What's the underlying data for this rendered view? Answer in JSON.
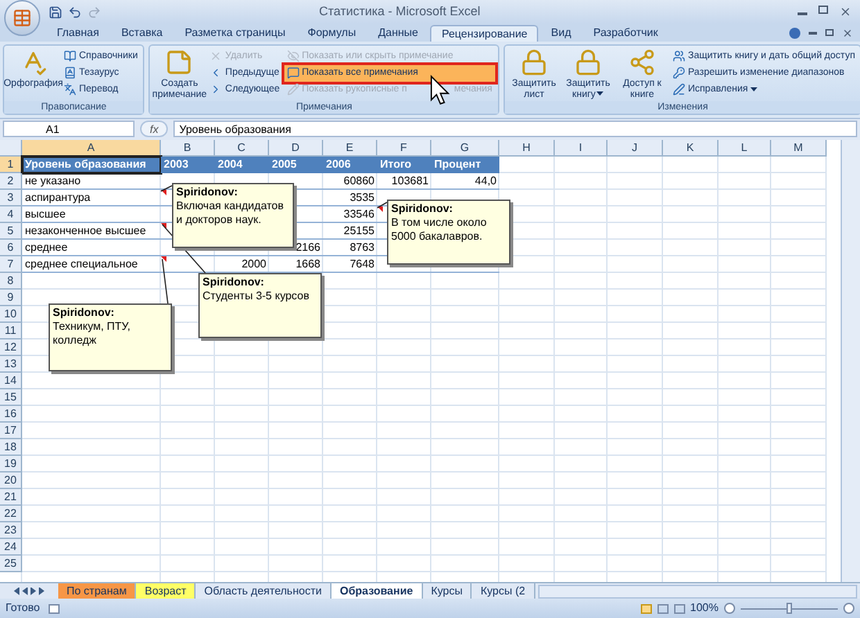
{
  "window": {
    "title": "Статистика - Microsoft Excel"
  },
  "ribbon_tabs": [
    {
      "label": "Главная",
      "selected": false
    },
    {
      "label": "Вставка",
      "selected": false
    },
    {
      "label": "Разметка страницы",
      "selected": false
    },
    {
      "label": "Формулы",
      "selected": false
    },
    {
      "label": "Данные",
      "selected": false
    },
    {
      "label": "Рецензирование",
      "selected": true
    },
    {
      "label": "Вид",
      "selected": false
    },
    {
      "label": "Разработчик",
      "selected": false
    }
  ],
  "ribbon_groups": [
    {
      "title": "Правописание",
      "items": [
        {
          "label": "Орфография",
          "kind": "large",
          "disabled": false
        },
        {
          "label": "Справочники",
          "kind": "small",
          "disabled": false
        },
        {
          "label": "Тезаурус",
          "kind": "small",
          "disabled": false
        },
        {
          "label": "Перевод",
          "kind": "small",
          "disabled": false
        }
      ]
    },
    {
      "title": "Примечания",
      "items": [
        {
          "label": "Создать примечание",
          "kind": "large",
          "disabled": false
        },
        {
          "label": "Удалить",
          "kind": "small",
          "disabled": true
        },
        {
          "label": "Предыдуще",
          "kind": "small",
          "disabled": false
        },
        {
          "label": "Следующее",
          "kind": "small",
          "disabled": false
        },
        {
          "label": "Показать или скрыть примечание",
          "kind": "small",
          "disabled": true
        },
        {
          "label": "Показать все примечания",
          "kind": "small",
          "disabled": false,
          "highlighted": true
        },
        {
          "label": "Показать рукописные п",
          "label_tail": "мечания",
          "kind": "small",
          "disabled": true
        }
      ]
    },
    {
      "title": "Изменения",
      "items": [
        {
          "label": "Защитить лист",
          "kind": "large",
          "disabled": false
        },
        {
          "label": "Защитить книгу",
          "kind": "large",
          "disabled": false,
          "dropdown": true
        },
        {
          "label": "Доступ к книге",
          "kind": "large",
          "disabled": false
        },
        {
          "label": "Защитить книгу и дать общий доступ",
          "kind": "small",
          "disabled": false
        },
        {
          "label": "Разрешить изменение диапазонов",
          "kind": "small",
          "disabled": false
        },
        {
          "label": "Исправления",
          "kind": "small",
          "disabled": false,
          "dropdown": true
        }
      ]
    }
  ],
  "name_box": "A1",
  "formula_label": "fx",
  "formula": "Уровень образования",
  "columns": [
    {
      "label": "A",
      "selected": true
    },
    {
      "label": "B",
      "selected": false
    },
    {
      "label": "C",
      "selected": false
    },
    {
      "label": "D",
      "selected": false
    },
    {
      "label": "E",
      "selected": false
    },
    {
      "label": "F",
      "selected": false
    },
    {
      "label": "G",
      "selected": false
    },
    {
      "label": "H",
      "selected": false
    },
    {
      "label": "I",
      "selected": false
    },
    {
      "label": "J",
      "selected": false
    },
    {
      "label": "K",
      "selected": false
    },
    {
      "label": "L",
      "selected": false
    },
    {
      "label": "M",
      "selected": false
    }
  ],
  "rows": [
    {
      "number": "1",
      "selected": true,
      "kind": "header",
      "cells": {
        "A": "Уровень образования",
        "B": "2003",
        "C": "2004",
        "D": "2005",
        "E": "2006",
        "F": "Итого",
        "G": "Процент"
      }
    },
    {
      "number": "2",
      "selected": false,
      "kind": "data",
      "cells": {
        "A": "не указано",
        "E": "60860",
        "F": "103681",
        "G": "44,0"
      }
    },
    {
      "number": "3",
      "selected": false,
      "kind": "data",
      "cells": {
        "A": "аспирантура",
        "E": "3535"
      }
    },
    {
      "number": "4",
      "selected": false,
      "kind": "data",
      "cells": {
        "A": "высшее",
        "E": "33546"
      }
    },
    {
      "number": "5",
      "selected": false,
      "kind": "data",
      "cells": {
        "A": "незаконченное высшее",
        "E": "25155"
      }
    },
    {
      "number": "6",
      "selected": false,
      "kind": "data",
      "cells": {
        "A": "среднее",
        "D": "2166",
        "E": "8763"
      }
    },
    {
      "number": "7",
      "selected": false,
      "kind": "data",
      "cells": {
        "A": "среднее специальное",
        "C": "2000",
        "D": "1668",
        "E": "7648"
      }
    },
    {
      "number": "8",
      "selected": false,
      "kind": "blank"
    },
    {
      "number": "9",
      "selected": false,
      "kind": "blank"
    },
    {
      "number": "10",
      "selected": false,
      "kind": "blank"
    },
    {
      "number": "11",
      "selected": false,
      "kind": "blank"
    },
    {
      "number": "12",
      "selected": false,
      "kind": "blank"
    },
    {
      "number": "13",
      "selected": false,
      "kind": "blank"
    },
    {
      "number": "14",
      "selected": false,
      "kind": "blank"
    },
    {
      "number": "15",
      "selected": false,
      "kind": "blank"
    },
    {
      "number": "16",
      "selected": false,
      "kind": "blank"
    },
    {
      "number": "17",
      "selected": false,
      "kind": "blank"
    },
    {
      "number": "18",
      "selected": false,
      "kind": "blank"
    },
    {
      "number": "19",
      "selected": false,
      "kind": "blank"
    },
    {
      "number": "20",
      "selected": false,
      "kind": "blank"
    },
    {
      "number": "21",
      "selected": false,
      "kind": "blank"
    },
    {
      "number": "22",
      "selected": false,
      "kind": "blank"
    },
    {
      "number": "23",
      "selected": false,
      "kind": "blank"
    },
    {
      "number": "24",
      "selected": false,
      "kind": "blank"
    },
    {
      "number": "25",
      "selected": false,
      "kind": "blank"
    }
  ],
  "comments": [
    {
      "author": "Spiridonov:",
      "text": "Включая кандидатов и докторов наук."
    },
    {
      "author": "Spiridonov:",
      "text": "В том числе около 5000 бакалавров."
    },
    {
      "author": "Spiridonov:",
      "text": "Студенты 3-5 курсов"
    },
    {
      "author": "Spiridonov:",
      "text": "Техникум, ПТУ, колледж"
    }
  ],
  "sheet_tabs": [
    {
      "label": "По странам",
      "selected": false,
      "color": "#f79646"
    },
    {
      "label": "Возраст",
      "selected": false,
      "color": "#ffff66"
    },
    {
      "label": "Область деятельности",
      "selected": false
    },
    {
      "label": "Образование",
      "selected": true
    },
    {
      "label": "Курсы",
      "selected": false
    },
    {
      "label": "Курсы (2",
      "selected": false
    }
  ],
  "status_bar": {
    "text": "Готово",
    "zoom": "100%",
    "level": 0.5
  }
}
